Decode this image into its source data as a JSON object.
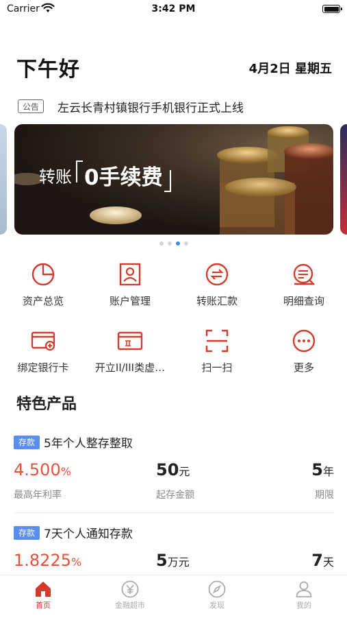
{
  "status_bar": {
    "carrier": "Carrier",
    "time": "3:42 PM"
  },
  "header": {
    "greeting": "下午好",
    "date": "4月2日 星期五"
  },
  "notice": {
    "tag": "公告",
    "text": "左云长青村镇银行手机银行正式上线"
  },
  "banner": {
    "prefix": "转账",
    "highlight": "0手续费",
    "page_count": 4,
    "active_page": 3
  },
  "quick_actions": [
    {
      "label": "资产总览",
      "icon": "pie-chart-icon"
    },
    {
      "label": "账户管理",
      "icon": "account-card-icon"
    },
    {
      "label": "转账汇款",
      "icon": "transfer-icon"
    },
    {
      "label": "明细查询",
      "icon": "detail-search-icon"
    },
    {
      "label": "绑定银行卡",
      "icon": "bind-card-icon"
    },
    {
      "label": "开立II/III类虚…",
      "icon": "virtual-card-icon"
    },
    {
      "label": "扫一扫",
      "icon": "scan-icon"
    },
    {
      "label": "更多",
      "icon": "more-icon"
    }
  ],
  "featured": {
    "title": "特色产品",
    "products": [
      {
        "tag": "存款",
        "name": "5年个人整存整取",
        "rate": "4.500",
        "rate_unit": "%",
        "rate_label": "最高年利率",
        "amount": "50",
        "amount_unit": "元",
        "amount_label": "起存金额",
        "term": "5",
        "term_unit": "年",
        "term_label": "期限"
      },
      {
        "tag": "存款",
        "name": "7天个人通知存款",
        "rate": "1.8225",
        "rate_unit": "%",
        "amount": "5",
        "amount_unit": "万元",
        "term": "7",
        "term_unit": "天"
      }
    ]
  },
  "tabbar": [
    {
      "label": "首页",
      "icon": "home-icon",
      "active": true
    },
    {
      "label": "金融超市",
      "icon": "yen-icon",
      "active": false
    },
    {
      "label": "发现",
      "icon": "compass-icon",
      "active": false
    },
    {
      "label": "我的",
      "icon": "user-icon",
      "active": false
    }
  ],
  "colors": {
    "accent": "#d33a2c",
    "rate": "#e8503a",
    "tag": "#5b8def",
    "dot_active": "#3a8ee6"
  }
}
